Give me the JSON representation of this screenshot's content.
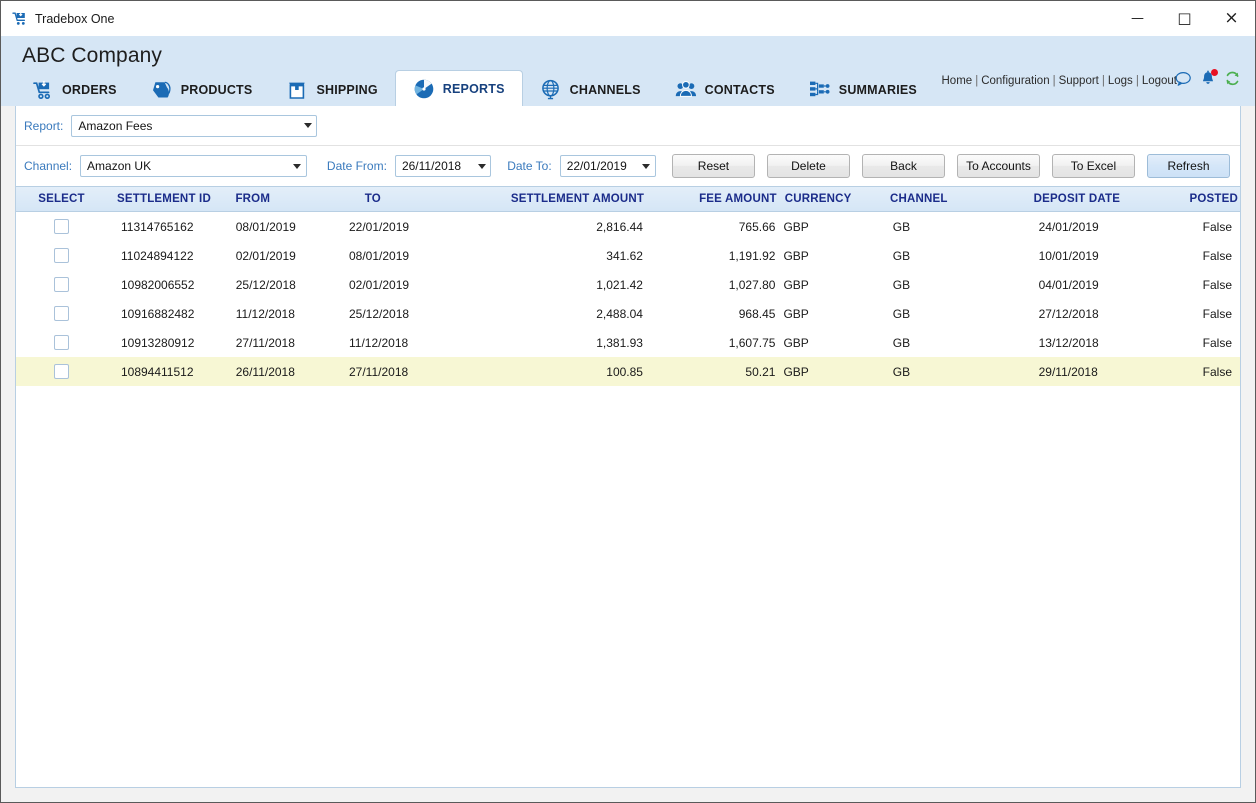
{
  "window": {
    "app_title": "Tradebox One",
    "icon": "shopping-cart-icon",
    "minimize": "—",
    "maximize": "□",
    "close": "×"
  },
  "header": {
    "company": "ABC Company",
    "links": [
      "Home",
      "Configuration",
      "Support",
      "Logs",
      "Logout"
    ],
    "separator": "|",
    "icons": [
      "chat-bubble-icon",
      "bell-notification-icon",
      "sync-refresh-icon"
    ],
    "accent_blue": "#1b6bb5",
    "band_color": "#d6e6f5",
    "notification_dot_color": "#e81123",
    "sync_icon_color": "#4caf50"
  },
  "tabs": [
    {
      "label": "ORDERS",
      "icon": "shopping-cart-icon",
      "active": false
    },
    {
      "label": "PRODUCTS",
      "icon": "price-tag-icon",
      "active": false
    },
    {
      "label": "SHIPPING",
      "icon": "shipping-box-icon",
      "active": false
    },
    {
      "label": "REPORTS",
      "icon": "pie-chart-icon",
      "active": true
    },
    {
      "label": "CHANNELS",
      "icon": "globe-icon",
      "active": false
    },
    {
      "label": "CONTACTS",
      "icon": "people-icon",
      "active": false
    },
    {
      "label": "SUMMARIES",
      "icon": "sitemap-icon",
      "active": false
    }
  ],
  "filters": {
    "report_label": "Report:",
    "report_value": "Amazon Fees",
    "channel_label": "Channel:",
    "channel_value": "Amazon UK",
    "date_from_label": "Date From:",
    "date_from_value": "26/11/2018",
    "date_to_label": "Date To:",
    "date_to_value": "22/01/2019"
  },
  "buttons": {
    "reset": "Reset",
    "delete": "Delete",
    "back": "Back",
    "to_accounts": "To Accounts",
    "to_excel": "To Excel",
    "refresh": "Refresh"
  },
  "grid": {
    "columns": [
      "SELECT",
      "SETTLEMENT ID",
      "FROM",
      "TO",
      "SETTLEMENT AMOUNT",
      "FEE AMOUNT",
      "CURRENCY",
      "CHANNEL",
      "DEPOSIT DATE",
      "POSTED"
    ],
    "selected_row_index": 5,
    "selected_row_color": "#f7f7d4",
    "header_text_color": "#1b2c8a",
    "rows": [
      {
        "select": false,
        "settlement_id": "11314765162",
        "from": "08/01/2019",
        "to": "22/01/2019",
        "settlement_amount": "2,816.44",
        "fee_amount": "765.66",
        "currency": "GBP",
        "channel": "GB",
        "deposit_date": "24/01/2019",
        "posted": "False"
      },
      {
        "select": false,
        "settlement_id": "11024894122",
        "from": "02/01/2019",
        "to": "08/01/2019",
        "settlement_amount": "341.62",
        "fee_amount": "1,191.92",
        "currency": "GBP",
        "channel": "GB",
        "deposit_date": "10/01/2019",
        "posted": "False"
      },
      {
        "select": false,
        "settlement_id": "10982006552",
        "from": "25/12/2018",
        "to": "02/01/2019",
        "settlement_amount": "1,021.42",
        "fee_amount": "1,027.80",
        "currency": "GBP",
        "channel": "GB",
        "deposit_date": "04/01/2019",
        "posted": "False"
      },
      {
        "select": false,
        "settlement_id": "10916882482",
        "from": "11/12/2018",
        "to": "25/12/2018",
        "settlement_amount": "2,488.04",
        "fee_amount": "968.45",
        "currency": "GBP",
        "channel": "GB",
        "deposit_date": "27/12/2018",
        "posted": "False"
      },
      {
        "select": false,
        "settlement_id": "10913280912",
        "from": "27/11/2018",
        "to": "11/12/2018",
        "settlement_amount": "1,381.93",
        "fee_amount": "1,607.75",
        "currency": "GBP",
        "channel": "GB",
        "deposit_date": "13/12/2018",
        "posted": "False"
      },
      {
        "select": false,
        "settlement_id": "10894411512",
        "from": "26/11/2018",
        "to": "27/11/2018",
        "settlement_amount": "100.85",
        "fee_amount": "50.21",
        "currency": "GBP",
        "channel": "GB",
        "deposit_date": "29/11/2018",
        "posted": "False"
      }
    ]
  }
}
